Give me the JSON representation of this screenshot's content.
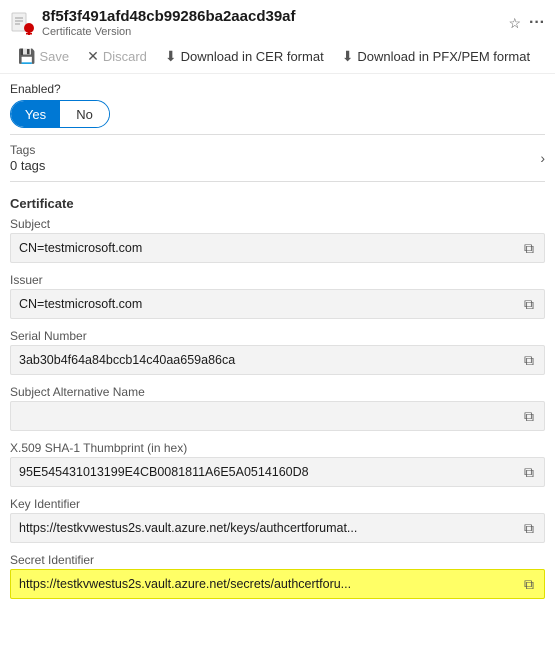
{
  "header": {
    "title": "8f5f3f491afd48cb99286ba2aacd39af",
    "subtitle": "Certificate Version",
    "pin_icon": "📌",
    "more_icon": "..."
  },
  "toolbar": {
    "save_label": "Save",
    "discard_label": "Discard",
    "download_cer_label": "Download in CER format",
    "download_pfx_label": "Download in PFX/PEM format"
  },
  "enabled": {
    "label": "Enabled?",
    "yes_label": "Yes",
    "no_label": "No"
  },
  "tags": {
    "label": "Tags",
    "count_label": "0 tags"
  },
  "certificate": {
    "section_label": "Certificate",
    "subject": {
      "label": "Subject",
      "value": "CN=testmicrosoft.com"
    },
    "issuer": {
      "label": "Issuer",
      "value": "CN=testmicrosoft.com"
    },
    "serial_number": {
      "label": "Serial Number",
      "value": "3ab30b4f64a84bccb14c40aa659a86ca"
    },
    "subject_alt_name": {
      "label": "Subject Alternative Name",
      "value": ""
    },
    "thumbprint": {
      "label": "X.509 SHA-1 Thumbprint (in hex)",
      "value": "95E545431013199E4CB0081811A6E5A0514160D8"
    },
    "key_identifier": {
      "label": "Key Identifier",
      "value": "https://testkvwestus2s.vault.azure.net/keys/authcertforumat..."
    },
    "secret_identifier": {
      "label": "Secret Identifier",
      "value": "https://testkvwestus2s.vault.azure.net/secrets/authcertforu..."
    }
  }
}
